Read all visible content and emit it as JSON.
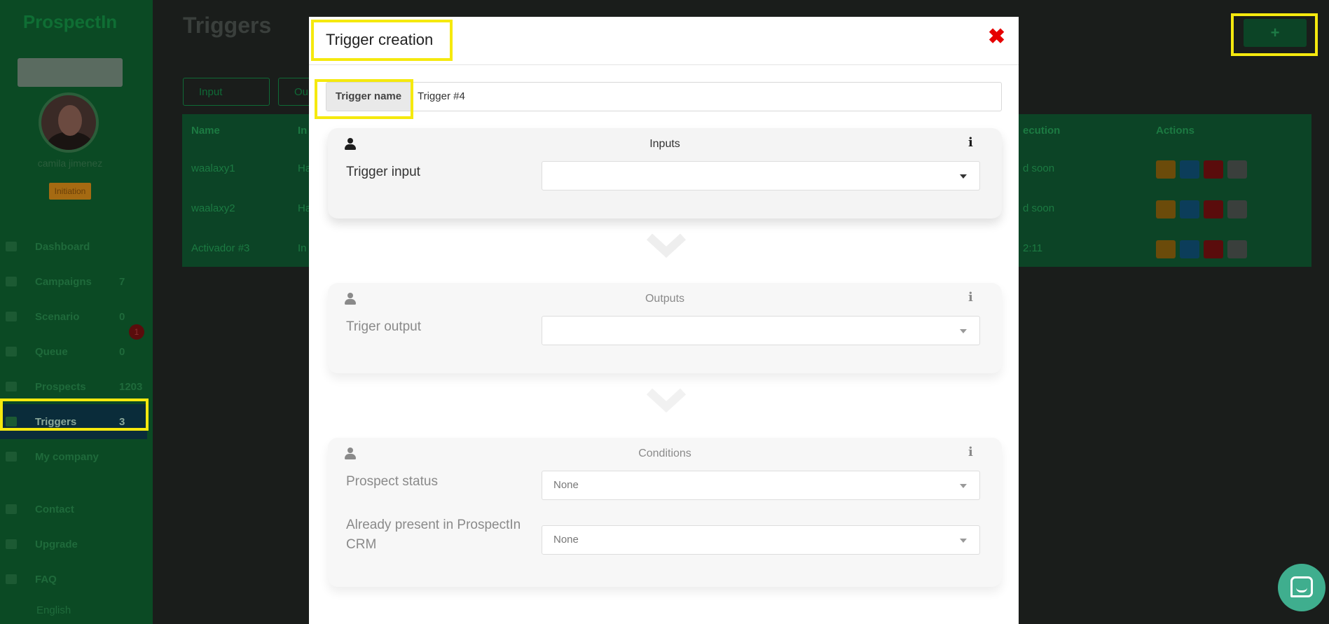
{
  "app": {
    "logo": "ProspectIn"
  },
  "sidebar": {
    "username": "camila jimenez",
    "plan_badge": "Initiation",
    "items": [
      {
        "label": "Dashboard",
        "count": "",
        "icon": "home-icon"
      },
      {
        "label": "Campaigns",
        "count": "7",
        "icon": "list-icon"
      },
      {
        "label": "Scenario",
        "count": "0",
        "icon": "filter-icon"
      },
      {
        "label": "Queue",
        "count": "0",
        "icon": "sync-icon"
      },
      {
        "label": "Prospects",
        "count": "1203",
        "icon": "user-icon"
      },
      {
        "label": "Triggers",
        "count": "3",
        "icon": "power-icon"
      },
      {
        "label": "My company",
        "count": "",
        "icon": "building-icon"
      }
    ],
    "queue_badge": "1",
    "bottom_items": [
      {
        "label": "Contact",
        "icon": "envelope-icon"
      },
      {
        "label": "Upgrade",
        "icon": "rocket-icon"
      },
      {
        "label": "FAQ",
        "icon": "question-icon"
      }
    ],
    "language": "English"
  },
  "page": {
    "title": "Triggers",
    "add_label": "+",
    "filters": [
      {
        "label": "Input"
      },
      {
        "label": "Ou"
      }
    ],
    "table": {
      "headers": [
        "Name",
        "In",
        "ecution",
        "Actions"
      ],
      "rows": [
        {
          "name": "waalaxy1",
          "input": "Ha",
          "execution": "d soon"
        },
        {
          "name": "waalaxy2",
          "input": "Ha",
          "execution": "d soon"
        },
        {
          "name": "Activador #3",
          "input": "In",
          "execution": "2:11"
        }
      ]
    }
  },
  "modal": {
    "title": "Trigger creation",
    "close": "✖",
    "name_label": "Trigger name",
    "name_value": "Trigger #4",
    "inputs": {
      "title": "Inputs",
      "field_label": "Trigger input",
      "value": ""
    },
    "outputs": {
      "title": "Outputs",
      "field_label": "Triger output",
      "value": ""
    },
    "conditions": {
      "title": "Conditions",
      "status_label": "Prospect status",
      "status_value": "None",
      "crm_label": "Already present in ProspectIn CRM",
      "crm_value": "None"
    },
    "info_glyph": "i"
  },
  "colors": {
    "highlight": "#f5e90e",
    "close": "#e60000",
    "chat": "#3fae8e"
  }
}
